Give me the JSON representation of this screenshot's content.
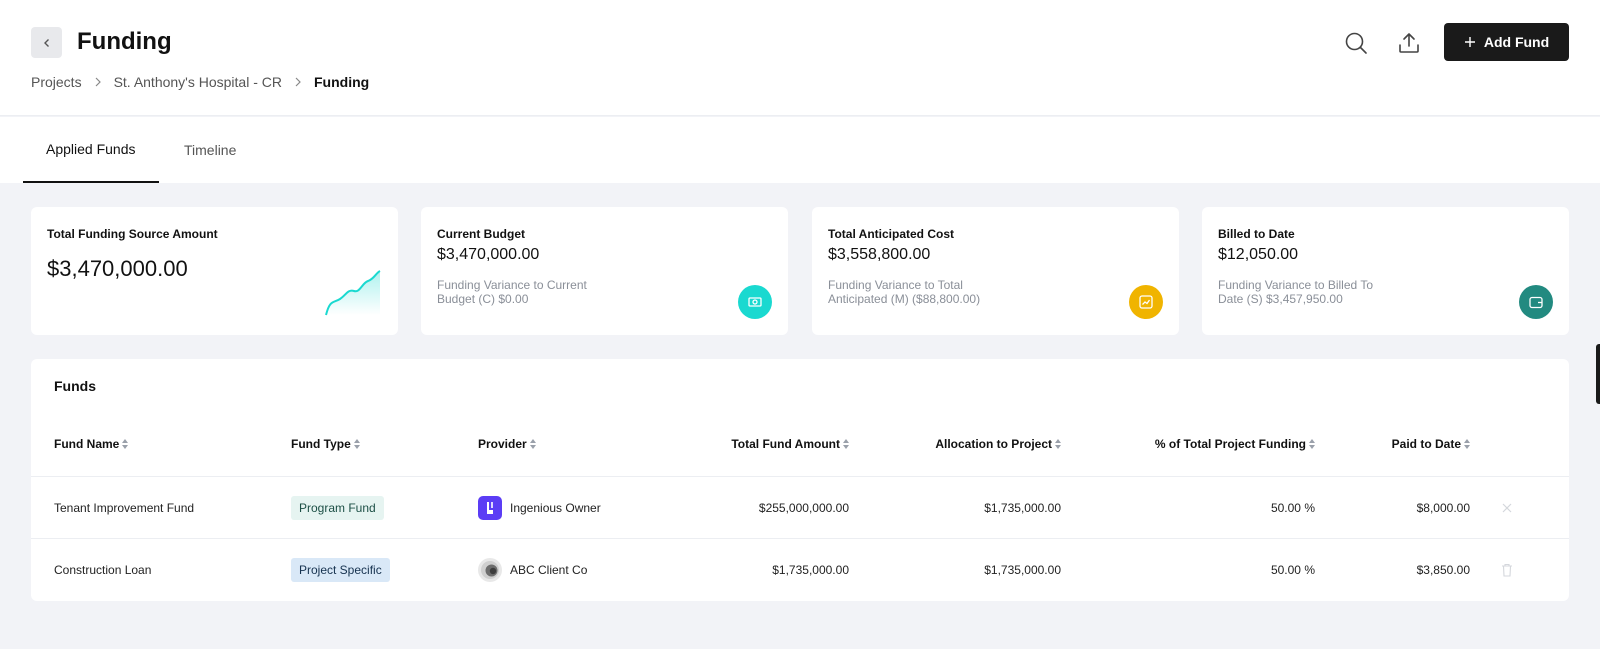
{
  "header": {
    "title": "Funding",
    "breadcrumb": [
      "Projects",
      "St. Anthony's Hospital - CR",
      "Funding"
    ],
    "add_button_label": "Add Fund"
  },
  "tabs": [
    {
      "label": "Applied Funds",
      "active": true
    },
    {
      "label": "Timeline",
      "active": false
    }
  ],
  "cards": [
    {
      "label": "Total Funding Source Amount",
      "amount": "$3,470,000.00",
      "variance": "",
      "icon": "trend-sparkline-icon"
    },
    {
      "label": "Current Budget",
      "amount": "$3,470,000.00",
      "variance": "Funding Variance to Current Budget (C) $0.00",
      "icon": "money-icon",
      "color": "#1ad9d0"
    },
    {
      "label": "Total Anticipated Cost",
      "amount": "$3,558,800.00",
      "variance": "Funding Variance to Total Anticipated (M) ($88,800.00)",
      "icon": "chart-icon",
      "color": "#f0b400"
    },
    {
      "label": "Billed to Date",
      "amount": "$12,050.00",
      "variance": "Funding Variance to Billed To Date (S) $3,457,950.00",
      "icon": "wallet-icon",
      "color": "#228a80"
    }
  ],
  "funds": {
    "title": "Funds",
    "columns": [
      "Fund Name",
      "Fund Type",
      "Provider",
      "Total Fund Amount",
      "Allocation to Project",
      "% of Total Project Funding",
      "Paid to Date"
    ],
    "rows": [
      {
        "name": "Tenant Improvement Fund",
        "type": "Program Fund",
        "provider": "Ingenious Owner",
        "total": "$255,000,000.00",
        "allocation": "$1,735,000.00",
        "percent": "50.00 %",
        "paid": "$8,000.00",
        "action": "close-icon"
      },
      {
        "name": "Construction Loan",
        "type": "Project Specific",
        "provider": "ABC Client Co",
        "total": "$1,735,000.00",
        "allocation": "$1,735,000.00",
        "percent": "50.00 %",
        "paid": "$3,850.00",
        "action": "trash-icon"
      }
    ]
  },
  "colors": {
    "accent_dark": "#1a1a1a",
    "teal": "#1ad9d0",
    "amber": "#f0b400",
    "dark_teal": "#228a80",
    "provider_purple": "#5b3df5"
  }
}
